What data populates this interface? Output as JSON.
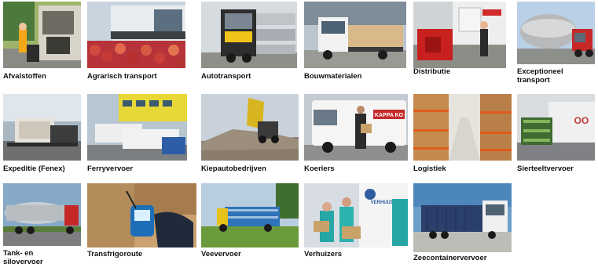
{
  "categories": [
    {
      "label": "Afvalstoffen",
      "icon": "garbage-truck-photo"
    },
    {
      "label": "Agrarisch transport",
      "icon": "apples-truck-photo"
    },
    {
      "label": "Autotransport",
      "icon": "car-transporter-photo"
    },
    {
      "label": "Bouwmaterialen",
      "icon": "building-materials-truck-photo"
    },
    {
      "label": "Distributie",
      "icon": "distribution-truck-photo"
    },
    {
      "label": "Exceptioneel\ntransport",
      "icon": "exceptional-transport-photo"
    },
    {
      "label": "Expeditie (Fenex)",
      "icon": "air-cargo-photo"
    },
    {
      "label": "Ferryvervoer",
      "icon": "ferry-trailers-photo"
    },
    {
      "label": "Kiepautobedrijven",
      "icon": "dump-truck-photo"
    },
    {
      "label": "Koeriers",
      "icon": "courier-van-photo"
    },
    {
      "label": "Logistiek",
      "icon": "warehouse-photo"
    },
    {
      "label": "Sierteeltvervoer",
      "icon": "plant-trolleys-photo"
    },
    {
      "label": "Tank- en\nsilovervoer",
      "icon": "tank-truck-photo"
    },
    {
      "label": "Transfrigoroute",
      "icon": "thermometer-photo"
    },
    {
      "label": "Veevervoer",
      "icon": "livestock-truck-photo"
    },
    {
      "label": "Verhuizers",
      "icon": "movers-photo"
    },
    {
      "label": "Zeecontainervervoer",
      "icon": "sea-container-truck-photo"
    }
  ],
  "van_text": "KAPPA KO",
  "movers_text": "VERHUIZERS"
}
